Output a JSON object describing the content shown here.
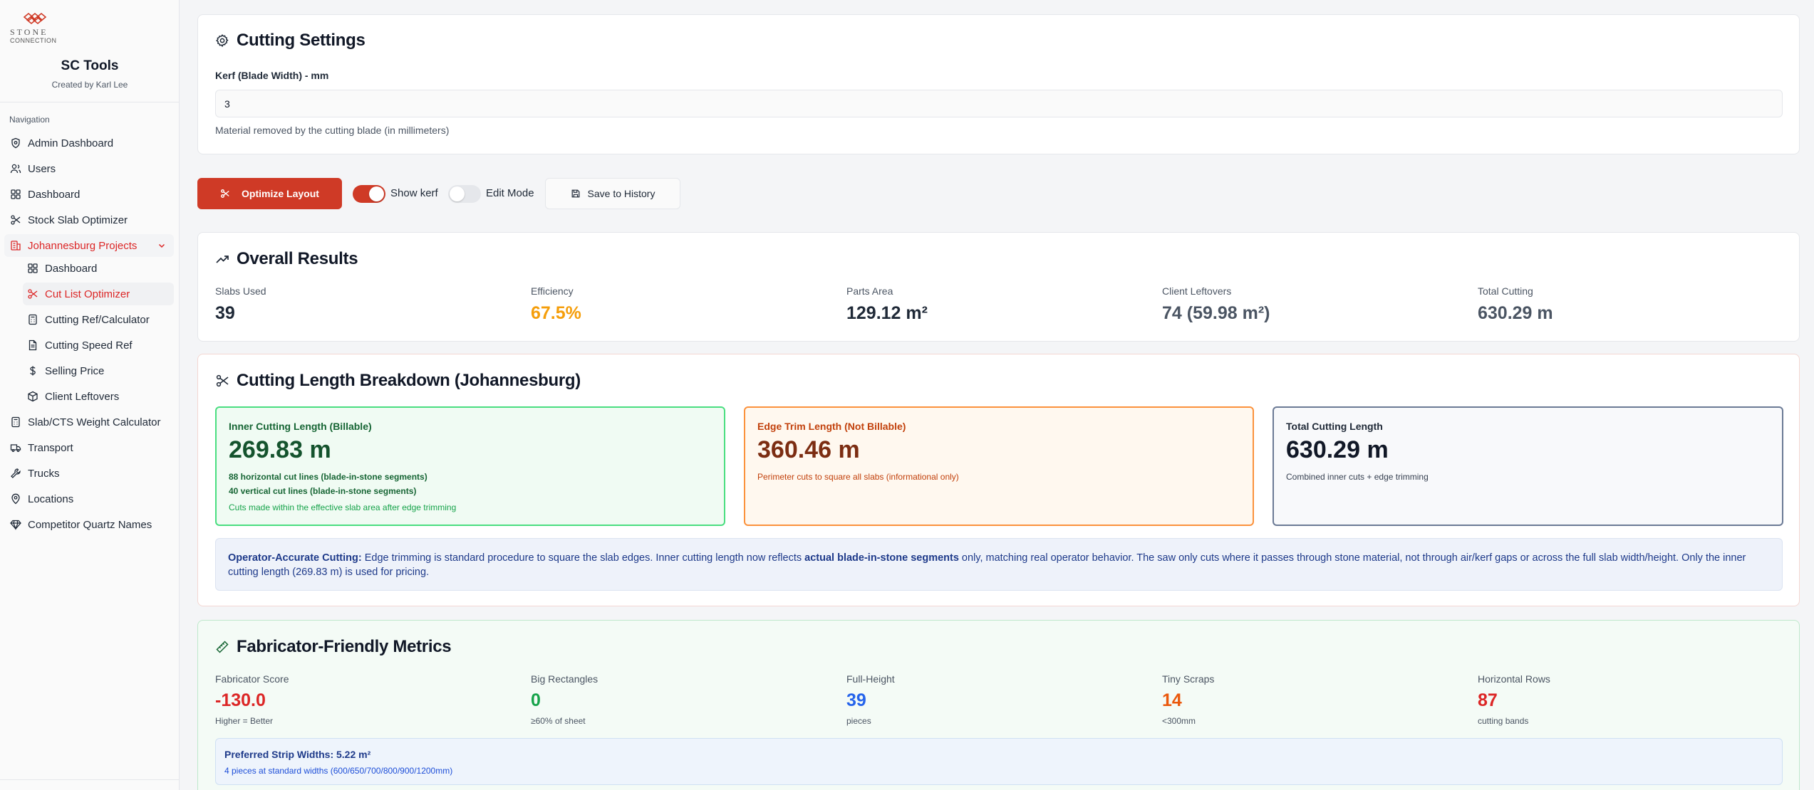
{
  "brand": {
    "logo_text": "STONE",
    "logo_sub": "CONNECTION",
    "app_title": "SC Tools",
    "app_subtitle": "Created by Karl Lee"
  },
  "nav": {
    "label": "Navigation",
    "items": [
      {
        "label": "Admin Dashboard",
        "icon": "shield-icon"
      },
      {
        "label": "Users",
        "icon": "users-icon"
      },
      {
        "label": "Dashboard",
        "icon": "grid-icon"
      },
      {
        "label": "Stock Slab Optimizer",
        "icon": "scissors-icon"
      },
      {
        "label": "Johannesburg Projects",
        "icon": "building-icon"
      },
      {
        "label": "Dashboard",
        "icon": "grid-icon"
      },
      {
        "label": "Cut List Optimizer",
        "icon": "scissors-icon"
      },
      {
        "label": "Cutting Ref/Calculator",
        "icon": "calculator-icon"
      },
      {
        "label": "Cutting Speed Ref",
        "icon": "document-icon"
      },
      {
        "label": "Selling Price",
        "icon": "dollar-icon"
      },
      {
        "label": "Client Leftovers",
        "icon": "boxes-icon"
      },
      {
        "label": "Slab/CTS Weight Calculator",
        "icon": "calculator-icon"
      },
      {
        "label": "Transport",
        "icon": "truck-icon"
      },
      {
        "label": "Trucks",
        "icon": "wrench-icon"
      },
      {
        "label": "Locations",
        "icon": "pin-icon"
      },
      {
        "label": "Competitor Quartz Names",
        "icon": "gem-icon"
      }
    ]
  },
  "cutting_settings": {
    "title": "Cutting Settings",
    "kerf_label": "Kerf (Blade Width) - mm",
    "kerf_value": "3",
    "kerf_help": "Material removed by the cutting blade (in millimeters)"
  },
  "actions": {
    "optimize_label": "Optimize Layout",
    "show_kerf_label": "Show kerf",
    "show_kerf_on": true,
    "edit_mode_label": "Edit Mode",
    "edit_mode_on": false,
    "save_label": "Save to History"
  },
  "overall": {
    "title": "Overall Results",
    "stats": [
      {
        "label": "Slabs Used",
        "value": "39",
        "color": "#1f2937"
      },
      {
        "label": "Efficiency",
        "value": "67.5%",
        "color": "#f59e0b"
      },
      {
        "label": "Parts Area",
        "value": "129.12 m²",
        "color": "#1f2937"
      },
      {
        "label": "Client Leftovers",
        "value": "74 (59.98 m²)",
        "color": "#4b5563"
      },
      {
        "label": "Total Cutting",
        "value": "630.29 m",
        "color": "#4b5563"
      }
    ]
  },
  "breakdown": {
    "title": "Cutting Length Breakdown (Johannesburg)",
    "inner": {
      "title": "Inner Cutting Length (Billable)",
      "value": "269.83 m",
      "line1": "88 horizontal cut lines (blade-in-stone segments)",
      "line2": "40 vertical cut lines (blade-in-stone segments)",
      "line3": "Cuts made within the effective slab area after edge trimming"
    },
    "edge": {
      "title": "Edge Trim Length (Not Billable)",
      "value": "360.46 m",
      "line1": "Perimeter cuts to square all slabs (informational only)"
    },
    "total": {
      "title": "Total Cutting Length",
      "value": "630.29 m",
      "line1": "Combined inner cuts + edge trimming"
    },
    "note": {
      "lead": "Operator-Accurate Cutting:",
      "part1": " Edge trimming is standard procedure to square the slab edges. Inner cutting length now reflects ",
      "bold": "actual blade-in-stone segments",
      "part2": " only, matching real operator behavior. The saw only cuts where it passes through stone material, not through air/kerf gaps or across the full slab width/height. Only the inner cutting length (269.83 m) is used for pricing."
    }
  },
  "fabricator": {
    "title": "Fabricator-Friendly Metrics",
    "metrics": [
      {
        "label": "Fabricator Score",
        "value": "-130.0",
        "sub": "Higher = Better",
        "color": "#dc2626"
      },
      {
        "label": "Big Rectangles",
        "value": "0",
        "sub": "≥60% of sheet",
        "color": "#16a34a"
      },
      {
        "label": "Full-Height",
        "value": "39",
        "sub": "pieces",
        "color": "#2563eb"
      },
      {
        "label": "Tiny Scraps",
        "value": "14",
        "sub": "<300mm",
        "color": "#ea580c"
      },
      {
        "label": "Horizontal Rows",
        "value": "87",
        "sub": "cutting bands",
        "color": "#dc2626"
      }
    ],
    "preferred_title": "Preferred Strip Widths: 5.22 m²",
    "preferred_sub": "4 pieces at standard widths (600/650/700/800/900/1200mm)"
  }
}
